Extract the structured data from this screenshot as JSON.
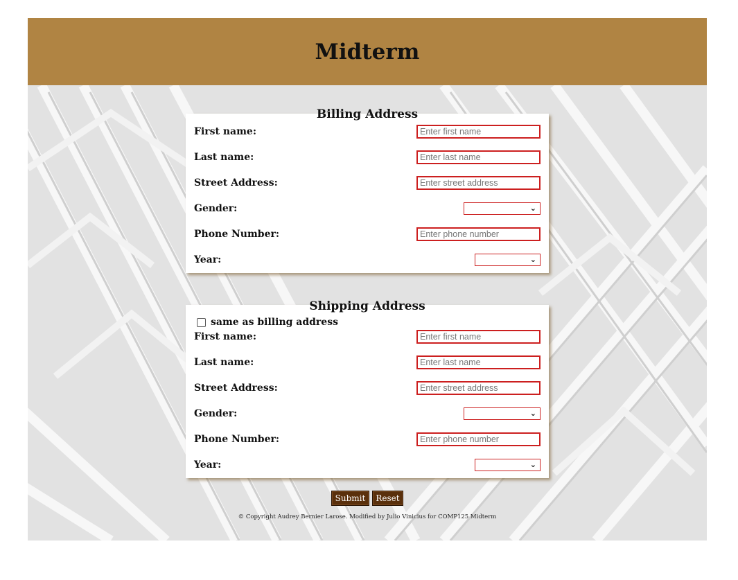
{
  "header": {
    "title": "Midterm"
  },
  "billing": {
    "title": "Billing Address",
    "first_name": {
      "label": "First name:",
      "placeholder": "Enter first name"
    },
    "last_name": {
      "label": "Last name:",
      "placeholder": "Enter last name"
    },
    "street": {
      "label": "Street Address:",
      "placeholder": "Enter street address"
    },
    "gender": {
      "label": "Gender:",
      "value": ""
    },
    "phone": {
      "label": "Phone Number:",
      "placeholder": "Enter phone number"
    },
    "year": {
      "label": "Year:",
      "value": ""
    }
  },
  "shipping": {
    "title": "Shipping Address",
    "same_as_billing": {
      "label": "same as billing address",
      "checked": false
    },
    "first_name": {
      "label": "First name:",
      "placeholder": "Enter first name"
    },
    "last_name": {
      "label": "Last name:",
      "placeholder": "Enter last name"
    },
    "street": {
      "label": "Street Address:",
      "placeholder": "Enter street address"
    },
    "gender": {
      "label": "Gender:",
      "value": ""
    },
    "phone": {
      "label": "Phone Number:",
      "placeholder": "Enter phone number"
    },
    "year": {
      "label": "Year:",
      "value": ""
    }
  },
  "buttons": {
    "submit": "Submit",
    "reset": "Reset"
  },
  "footer": {
    "text": "© Copyright Audrey Bernier Larose. Modified by Julio Vinicius for COMP125 Midterm"
  },
  "colors": {
    "header": "#b08443",
    "input_border": "#cc1f1f",
    "button": "#5a300c"
  },
  "icons": {
    "select": "chevron-down-icon",
    "checkbox": "checkbox-icon"
  }
}
